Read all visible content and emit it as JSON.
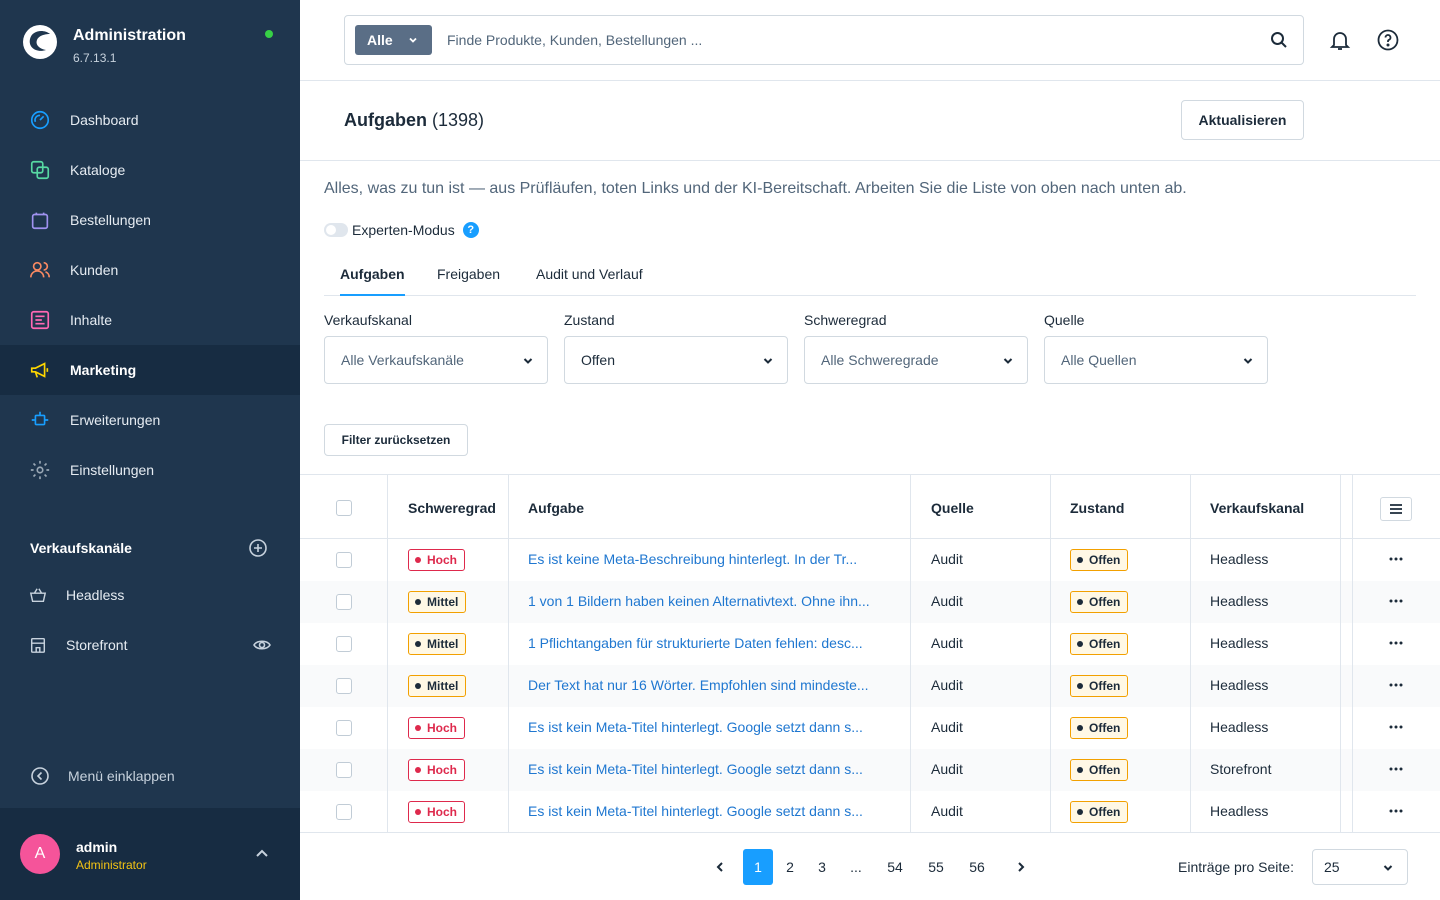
{
  "app": {
    "title": "Administration",
    "version": "6.7.13.1",
    "status_color": "#37d046"
  },
  "sidebar": {
    "items": [
      {
        "label": "Dashboard",
        "icon": "dashboard-icon",
        "color": "#189eff"
      },
      {
        "label": "Kataloge",
        "icon": "catalog-icon",
        "color": "#57d9a3"
      },
      {
        "label": "Bestellungen",
        "icon": "orders-icon",
        "color": "#a092f0"
      },
      {
        "label": "Kunden",
        "icon": "customers-icon",
        "color": "#f88962"
      },
      {
        "label": "Inhalte",
        "icon": "content-icon",
        "color": "#ff68b4"
      },
      {
        "label": "Marketing",
        "icon": "megaphone-icon",
        "color": "#ffd700",
        "active": true
      },
      {
        "label": "Erweiterungen",
        "icon": "extensions-icon",
        "color": "#189eff"
      },
      {
        "label": "Einstellungen",
        "icon": "gear-icon",
        "color": "#9aa8b5"
      }
    ],
    "sales_channels_title": "Verkaufskanäle",
    "sales_channels": [
      {
        "label": "Headless",
        "icon": "basket-icon"
      },
      {
        "label": "Storefront",
        "icon": "storefront-icon"
      }
    ],
    "collapse_label": "Menü einklappen",
    "user": {
      "initial": "A",
      "name": "admin",
      "role": "Administrator"
    }
  },
  "search": {
    "type_label": "Alle",
    "placeholder": "Finde Produkte, Kunden, Bestellungen ..."
  },
  "page": {
    "title": "Aufgaben",
    "count": "(1398)",
    "refresh_label": "Aktualisieren",
    "description": "Alles, was zu tun ist — aus Prüfläufen, toten Links und der KI-Bereitschaft. Arbeiten Sie die Liste von oben nach unten ab.",
    "expert_mode_label": "Experten-Modus",
    "expert_help": "?"
  },
  "tabs": [
    "Aufgaben",
    "Freigaben",
    "Audit und Verlauf"
  ],
  "filters": [
    {
      "label": "Verkaufskanal",
      "value": "Alle Verkaufskanäle"
    },
    {
      "label": "Zustand",
      "value": "Offen"
    },
    {
      "label": "Schweregrad",
      "value": "Alle Schweregrade"
    },
    {
      "label": "Quelle",
      "value": "Alle Quellen"
    }
  ],
  "reset_label": "Filter zurücksetzen",
  "table": {
    "columns": [
      "Schweregrad",
      "Aufgabe",
      "Quelle",
      "Zustand",
      "Verkaufskanal"
    ],
    "rows": [
      {
        "severity": "Hoch",
        "sev": "hoch",
        "task": "Es ist keine Meta-Beschreibung hinterlegt. In der Tr...",
        "source": "Audit",
        "state": "Offen",
        "channel": "Headless"
      },
      {
        "severity": "Mittel",
        "sev": "mittel",
        "task": "1 von 1 Bildern haben keinen Alternativtext. Ohne ihn...",
        "source": "Audit",
        "state": "Offen",
        "channel": "Headless"
      },
      {
        "severity": "Mittel",
        "sev": "mittel",
        "task": "1 Pflichtangaben für strukturierte Daten fehlen: desc...",
        "source": "Audit",
        "state": "Offen",
        "channel": "Headless"
      },
      {
        "severity": "Mittel",
        "sev": "mittel",
        "task": "Der Text hat nur 16 Wörter. Empfohlen sind mindeste...",
        "source": "Audit",
        "state": "Offen",
        "channel": "Headless"
      },
      {
        "severity": "Hoch",
        "sev": "hoch",
        "task": "Es ist kein Meta-Titel hinterlegt. Google setzt dann s...",
        "source": "Audit",
        "state": "Offen",
        "channel": "Headless"
      },
      {
        "severity": "Hoch",
        "sev": "hoch",
        "task": "Es ist kein Meta-Titel hinterlegt. Google setzt dann s...",
        "source": "Audit",
        "state": "Offen",
        "channel": "Storefront"
      },
      {
        "severity": "Hoch",
        "sev": "hoch",
        "task": "Es ist kein Meta-Titel hinterlegt. Google setzt dann s...",
        "source": "Audit",
        "state": "Offen",
        "channel": "Headless"
      }
    ]
  },
  "pagination": {
    "pages": [
      "1",
      "2",
      "3",
      "...",
      "54",
      "55",
      "56"
    ],
    "current": "1",
    "per_page_label": "Einträge pro Seite:",
    "per_page_value": "25"
  }
}
